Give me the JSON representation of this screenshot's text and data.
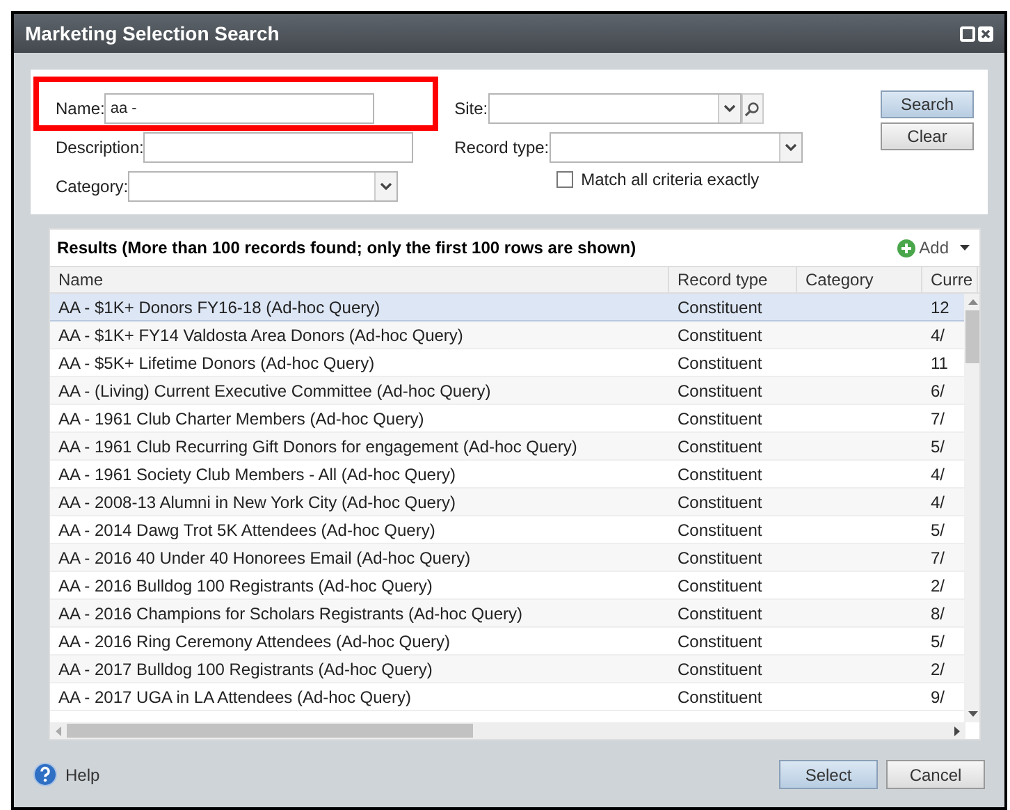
{
  "window": {
    "title": "Marketing Selection Search"
  },
  "filters": {
    "name": {
      "label": "Name:",
      "value": "aa -",
      "highlighted": true
    },
    "description": {
      "label": "Description:"
    },
    "category": {
      "label": "Category:"
    },
    "site": {
      "label": "Site:"
    },
    "record_type": {
      "label": "Record type:"
    },
    "match_all": {
      "label": "Match all criteria exactly",
      "checked": false
    }
  },
  "buttons": {
    "search": "Search",
    "clear": "Clear",
    "add": "Add",
    "help": "Help",
    "select": "Select",
    "cancel": "Cancel"
  },
  "results": {
    "title": "Results (More than 100 records found; only the first 100 rows are shown)",
    "columns": [
      "Name",
      "Record type",
      "Category",
      "Curre"
    ],
    "rows": [
      {
        "name": "AA - $1K+ Donors FY16-18 (Ad-hoc Query)",
        "record_type": "Constituent",
        "column_4": "12",
        "selected": true
      },
      {
        "name": "AA - $1K+ FY14 Valdosta Area Donors (Ad-hoc Query)",
        "record_type": "Constituent",
        "column_4": "4/",
        "selected": false
      },
      {
        "name": "AA - $5K+ Lifetime Donors (Ad-hoc Query)",
        "record_type": "Constituent",
        "column_4": "11",
        "selected": false
      },
      {
        "name": "AA - (Living) Current Executive Committee (Ad-hoc Query)",
        "record_type": "Constituent",
        "column_4": "6/",
        "selected": false
      },
      {
        "name": "AA - 1961 Club Charter Members (Ad-hoc Query)",
        "record_type": "Constituent",
        "column_4": "7/",
        "selected": false
      },
      {
        "name": "AA - 1961 Club Recurring Gift Donors for engagement (Ad-hoc Query)",
        "record_type": "Constituent",
        "column_4": "5/",
        "selected": false
      },
      {
        "name": "AA - 1961 Society Club Members - All (Ad-hoc Query)",
        "record_type": "Constituent",
        "column_4": "4/",
        "selected": false
      },
      {
        "name": "AA - 2008-13 Alumni in New York City (Ad-hoc Query)",
        "record_type": "Constituent",
        "column_4": "4/",
        "selected": false
      },
      {
        "name": "AA - 2014 Dawg Trot 5K Attendees (Ad-hoc Query)",
        "record_type": "Constituent",
        "column_4": "5/",
        "selected": false
      },
      {
        "name": "AA - 2016 40 Under 40 Honorees Email (Ad-hoc Query)",
        "record_type": "Constituent",
        "column_4": "7/",
        "selected": false
      },
      {
        "name": "AA - 2016 Bulldog 100 Registrants (Ad-hoc Query)",
        "record_type": "Constituent",
        "column_4": "2/",
        "selected": false
      },
      {
        "name": "AA - 2016 Champions for Scholars Registrants (Ad-hoc Query)",
        "record_type": "Constituent",
        "column_4": "8/",
        "selected": false
      },
      {
        "name": "AA - 2016 Ring Ceremony Attendees (Ad-hoc Query)",
        "record_type": "Constituent",
        "column_4": "5/",
        "selected": false
      },
      {
        "name": "AA - 2017 Bulldog 100 Registrants (Ad-hoc Query)",
        "record_type": "Constituent",
        "column_4": "2/",
        "selected": false
      },
      {
        "name": "AA - 2017 UGA in LA Attendees (Ad-hoc Query)",
        "record_type": "Constituent",
        "column_4": "9/",
        "selected": false
      }
    ]
  }
}
